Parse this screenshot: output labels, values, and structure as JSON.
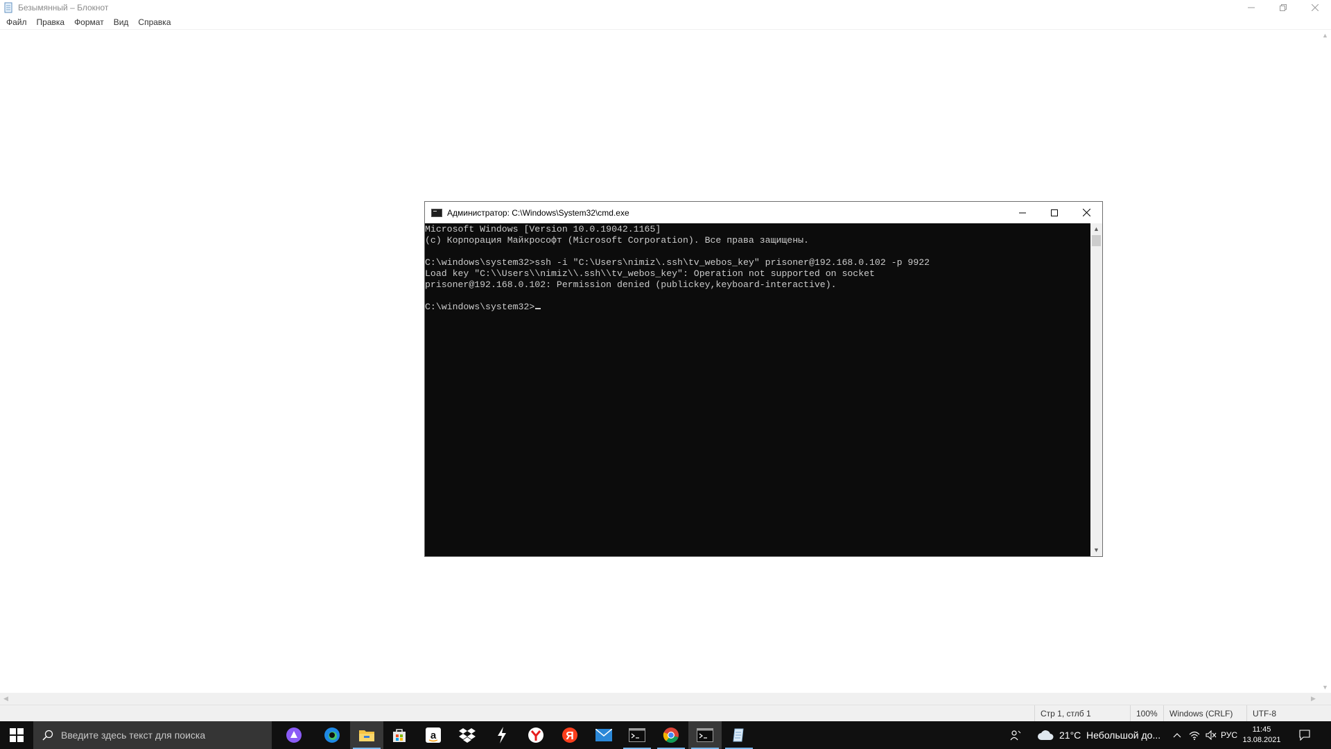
{
  "notepad": {
    "title": "Безымянный – Блокнот",
    "caption_minimize": "—",
    "caption_maximize": "❐",
    "caption_close": "✕",
    "menu": [
      "Файл",
      "Правка",
      "Формат",
      "Вид",
      "Справка"
    ],
    "status": {
      "position": "Стр 1, стлб 1",
      "zoom": "100%",
      "line_endings": "Windows (CRLF)",
      "encoding": "UTF-8"
    }
  },
  "cmd": {
    "title": "Администратор: C:\\Windows\\System32\\cmd.exe",
    "lines": [
      "Microsoft Windows [Version 10.0.19042.1165]",
      "(c) Корпорация Майкрософт (Microsoft Corporation). Все права защищены.",
      "",
      "C:\\windows\\system32>ssh -i \"C:\\Users\\nimiz\\.ssh\\tv_webos_key\" prisoner@192.168.0.102 -p 9922",
      "Load key \"C:\\\\Users\\\\nimiz\\\\.ssh\\\\tv_webos_key\": Operation not supported on socket",
      "prisoner@192.168.0.102: Permission denied (publickey,keyboard-interactive).",
      "",
      "C:\\windows\\system32>"
    ]
  },
  "taskbar": {
    "search_placeholder": "Введите здесь текст для поиска",
    "apps": [
      "cortana-icon",
      "edge-icon",
      "file-explorer-icon",
      "store-icon",
      "amazon-icon",
      "dropbox-icon",
      "lightning-app-icon",
      "yandex-browser-icon",
      "yandex-icon",
      "mail-icon",
      "cmd-icon",
      "chrome-icon",
      "cmd-icon",
      "notepad-icon"
    ],
    "weather": "21°C  Небольшой до...",
    "language": "РУС",
    "time": "11:45",
    "date": "13.08.2021",
    "accent": "#7ab8ee"
  }
}
